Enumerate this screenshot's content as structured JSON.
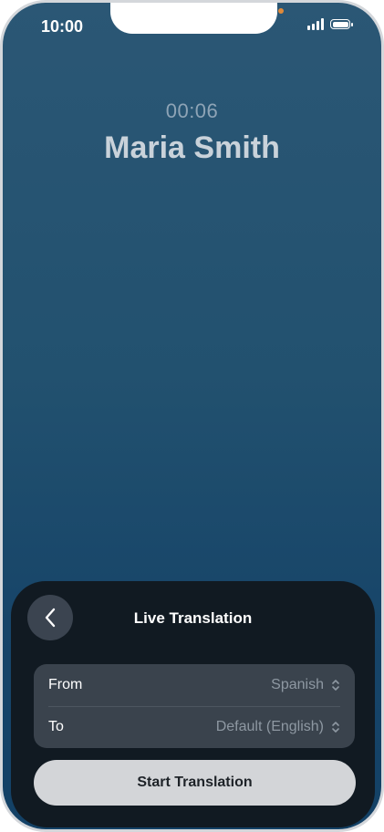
{
  "status_bar": {
    "time": "10:00"
  },
  "call": {
    "duration": "00:06",
    "caller_name": "Maria Smith"
  },
  "sheet": {
    "title": "Live Translation",
    "from": {
      "label": "From",
      "value": "Spanish"
    },
    "to": {
      "label": "To",
      "value": "Default (English)"
    },
    "start_button": "Start Translation"
  },
  "icons": {
    "back": "chevron-left-icon",
    "selector": "chevron-up-down-icon",
    "signal": "cellular-signal-icon",
    "battery": "battery-icon"
  }
}
